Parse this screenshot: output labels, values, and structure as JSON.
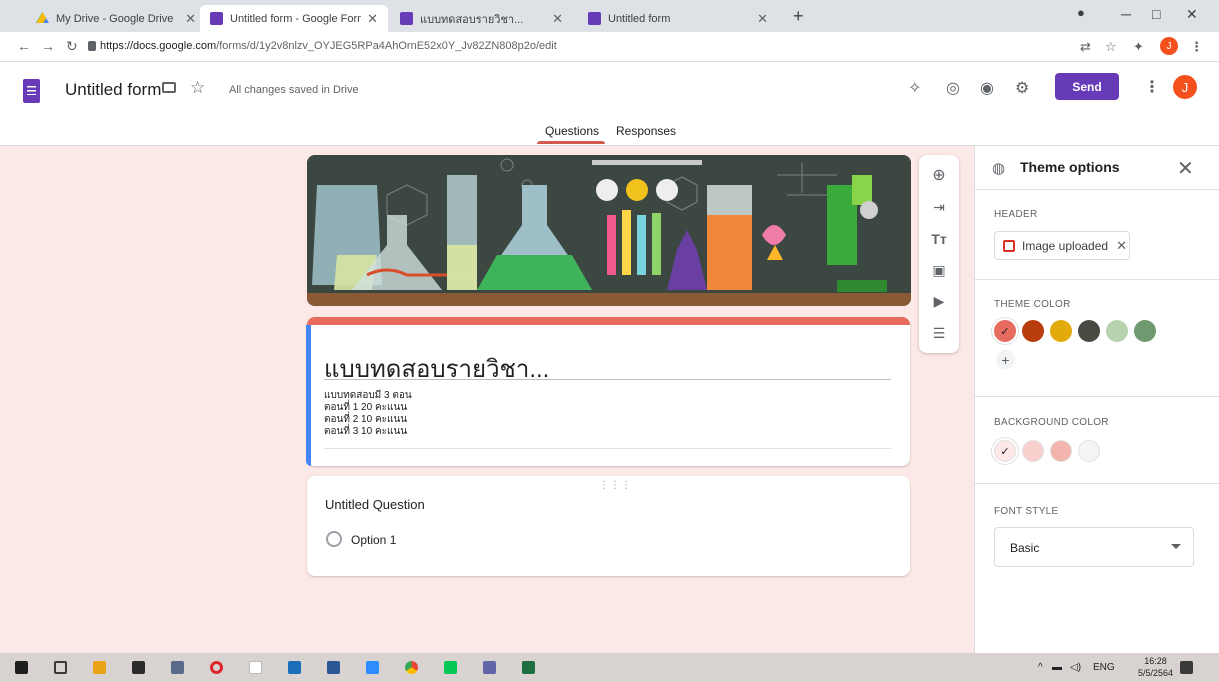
{
  "browser": {
    "tabs": [
      {
        "title": "My Drive - Google Drive",
        "favicon": "google-drive-icon",
        "active": false
      },
      {
        "title": "Untitled form - Google Forms",
        "favicon": "google-forms-icon",
        "active": true
      },
      {
        "title": "แบบทดสอบรายวิชา...",
        "favicon": "google-forms-icon",
        "active": false
      },
      {
        "title": "Untitled form",
        "favicon": "google-forms-icon",
        "active": false
      }
    ],
    "url_domain": "https://docs.google.com",
    "url_path": "/forms/d/1y2v8nlzv_OYJEG5RPa4AhOrnE52x0Y_Jv82ZN808p2o/edit",
    "profile_initial": "J"
  },
  "header": {
    "form_title": "Untitled form",
    "save_status": "All changes saved in Drive",
    "send_label": "Send",
    "avatar_initial": "J",
    "tabs": [
      "Questions",
      "Responses"
    ],
    "active_tab": "Questions"
  },
  "form": {
    "title": "แบบทดสอบรายวิชา...",
    "description": [
      "แบบทดสอบมี 3 ตอน",
      "ตอนที่ 1  20 คะแนน",
      "ตอนที่ 2  10 คะแนน",
      "ตอนที่ 3  10 คะแนน"
    ],
    "question": {
      "title": "Untitled Question",
      "options": [
        "Option 1"
      ]
    }
  },
  "theme_panel": {
    "title": "Theme options",
    "header_label": "HEADER",
    "header_chip": "Image uploaded",
    "theme_color_label": "THEME COLOR",
    "theme_colors": [
      "#e66a5e",
      "#b93c0e",
      "#e3aa0c",
      "#4a4a42",
      "#b7d3ae",
      "#6f9a70"
    ],
    "selected_theme_color": "#e66a5e",
    "background_color_label": "BACKGROUND COLOR",
    "background_colors": [
      "#fce8e6",
      "#f9d0cd",
      "#f4b4ae",
      "#f5f5f5"
    ],
    "selected_background_color": "#fce8e6",
    "font_style_label": "FONT STYLE",
    "font_style": "Basic"
  },
  "taskbar": {
    "language": "ENG",
    "time": "16:28",
    "date": "5/5/2564"
  }
}
